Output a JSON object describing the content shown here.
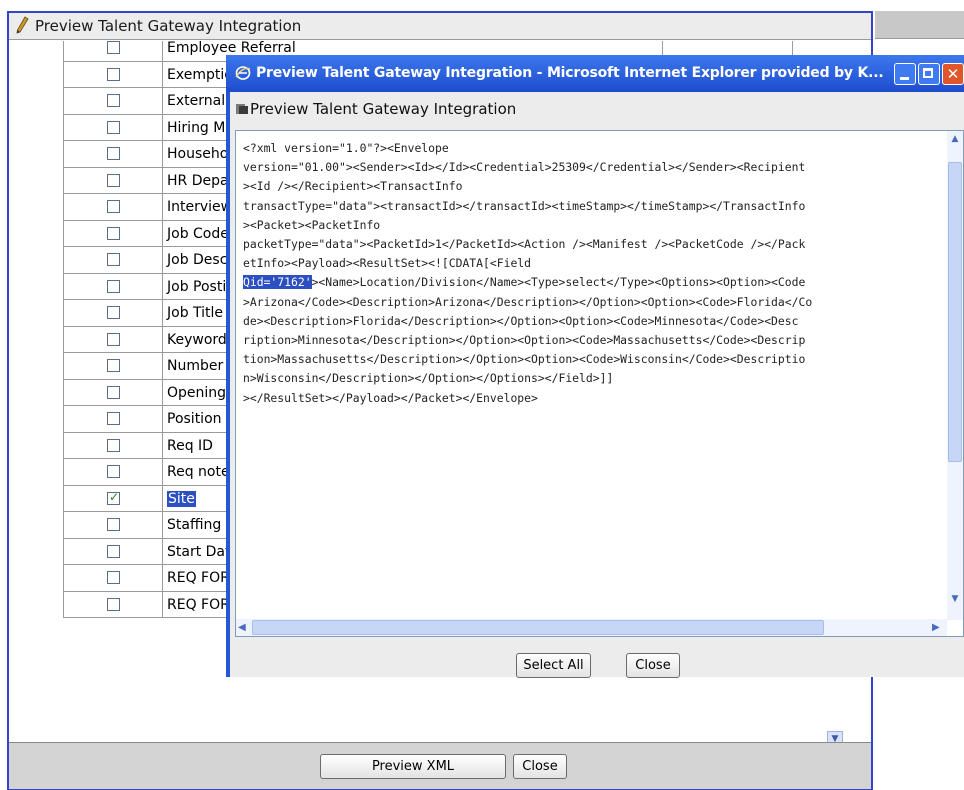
{
  "background_window": {
    "title": "Preview Talent Gateway Integration",
    "rows": [
      {
        "name": "Employee Referral",
        "type": "",
        "checked": false,
        "selected": false
      },
      {
        "name": "Exemption Status",
        "type": "",
        "checked": false,
        "selected": false
      },
      {
        "name": "External Posting",
        "type": "",
        "checked": false,
        "selected": false
      },
      {
        "name": "Hiring Manager",
        "type": "",
        "checked": false,
        "selected": false
      },
      {
        "name": "Household",
        "type": "",
        "checked": false,
        "selected": false
      },
      {
        "name": "HR Department",
        "type": "",
        "checked": false,
        "selected": false
      },
      {
        "name": "Interview",
        "type": "",
        "checked": false,
        "selected": false
      },
      {
        "name": "Job Code",
        "type": "",
        "checked": false,
        "selected": false
      },
      {
        "name": "Job Description",
        "type": "",
        "checked": false,
        "selected": false
      },
      {
        "name": "Job Posting",
        "type": "",
        "checked": false,
        "selected": false
      },
      {
        "name": "Job Title",
        "type": "",
        "checked": false,
        "selected": false
      },
      {
        "name": "Keywords",
        "type": "",
        "checked": false,
        "selected": false
      },
      {
        "name": "Number",
        "type": "",
        "checked": false,
        "selected": false
      },
      {
        "name": "Openings",
        "type": "",
        "checked": false,
        "selected": false
      },
      {
        "name": "Position",
        "type": "",
        "checked": false,
        "selected": false
      },
      {
        "name": "Req ID",
        "type": "",
        "checked": false,
        "selected": false
      },
      {
        "name": "Req notes",
        "type": "",
        "checked": false,
        "selected": false
      },
      {
        "name": "Site",
        "type": "",
        "checked": true,
        "selected": true
      },
      {
        "name": "Staffing",
        "type": "",
        "checked": false,
        "selected": false
      },
      {
        "name": "Start Date",
        "type": "",
        "checked": false,
        "selected": false
      },
      {
        "name": "REQ FORMS - Appt Type",
        "type": "single-select",
        "checked": false,
        "selected": false
      },
      {
        "name": "REQ FORMS - Basic Qualifications",
        "type": "textarea",
        "checked": false,
        "selected": false
      }
    ],
    "footer": {
      "preview_xml_label": "Preview XML",
      "close_label": "Close"
    }
  },
  "popup": {
    "window_title": "Preview Talent Gateway Integration - Microsoft Internet Explorer provided by K...",
    "close_glyph": "✕",
    "subtitle": "Preview Talent Gateway Integration",
    "xml_lines": [
      "<?xml version=\"1.0\"?><Envelope",
      "version=\"01.00\"><Sender><Id></Id><Credential>25309</Credential></Sender><Recipient",
      "><Id /></Recipient><TransactInfo",
      "transactType=\"data\"><transactId></transactId><timeStamp></timeStamp></TransactInfo",
      "><Packet><PacketInfo",
      "packetType=\"data\"><PacketId>1</PacketId><Action /><Manifest /><PacketCode /></Pack",
      "etInfo><Payload><ResultSet><![CDATA[<Field",
      "Qid='7162'><Name>Location/Division</Name><Type>select</Type><Options><Option><Code",
      ">Arizona</Code><Description>Arizona</Description></Option><Option><Code>Florida</Co",
      "de><Description>Florida</Description></Option><Option><Code>Minnesota</Code><Desc",
      "ription>Minnesota</Description></Option><Option><Code>Massachusetts</Code><Descrip",
      "tion>Massachusetts</Description></Option><Option><Code>Wisconsin</Code><Descriptio",
      "n>Wisconsin</Description></Option></Options></Field>]]",
      "></ResultSet></Payload></Packet></Envelope>"
    ],
    "selected_text": "Qid='7162'",
    "footer": {
      "select_all_label": "Select All",
      "close_label": "Close"
    }
  },
  "colors": {
    "title_blue": "#2656d8",
    "selection": "#2c4fc2",
    "close_red": "#e0562a"
  }
}
